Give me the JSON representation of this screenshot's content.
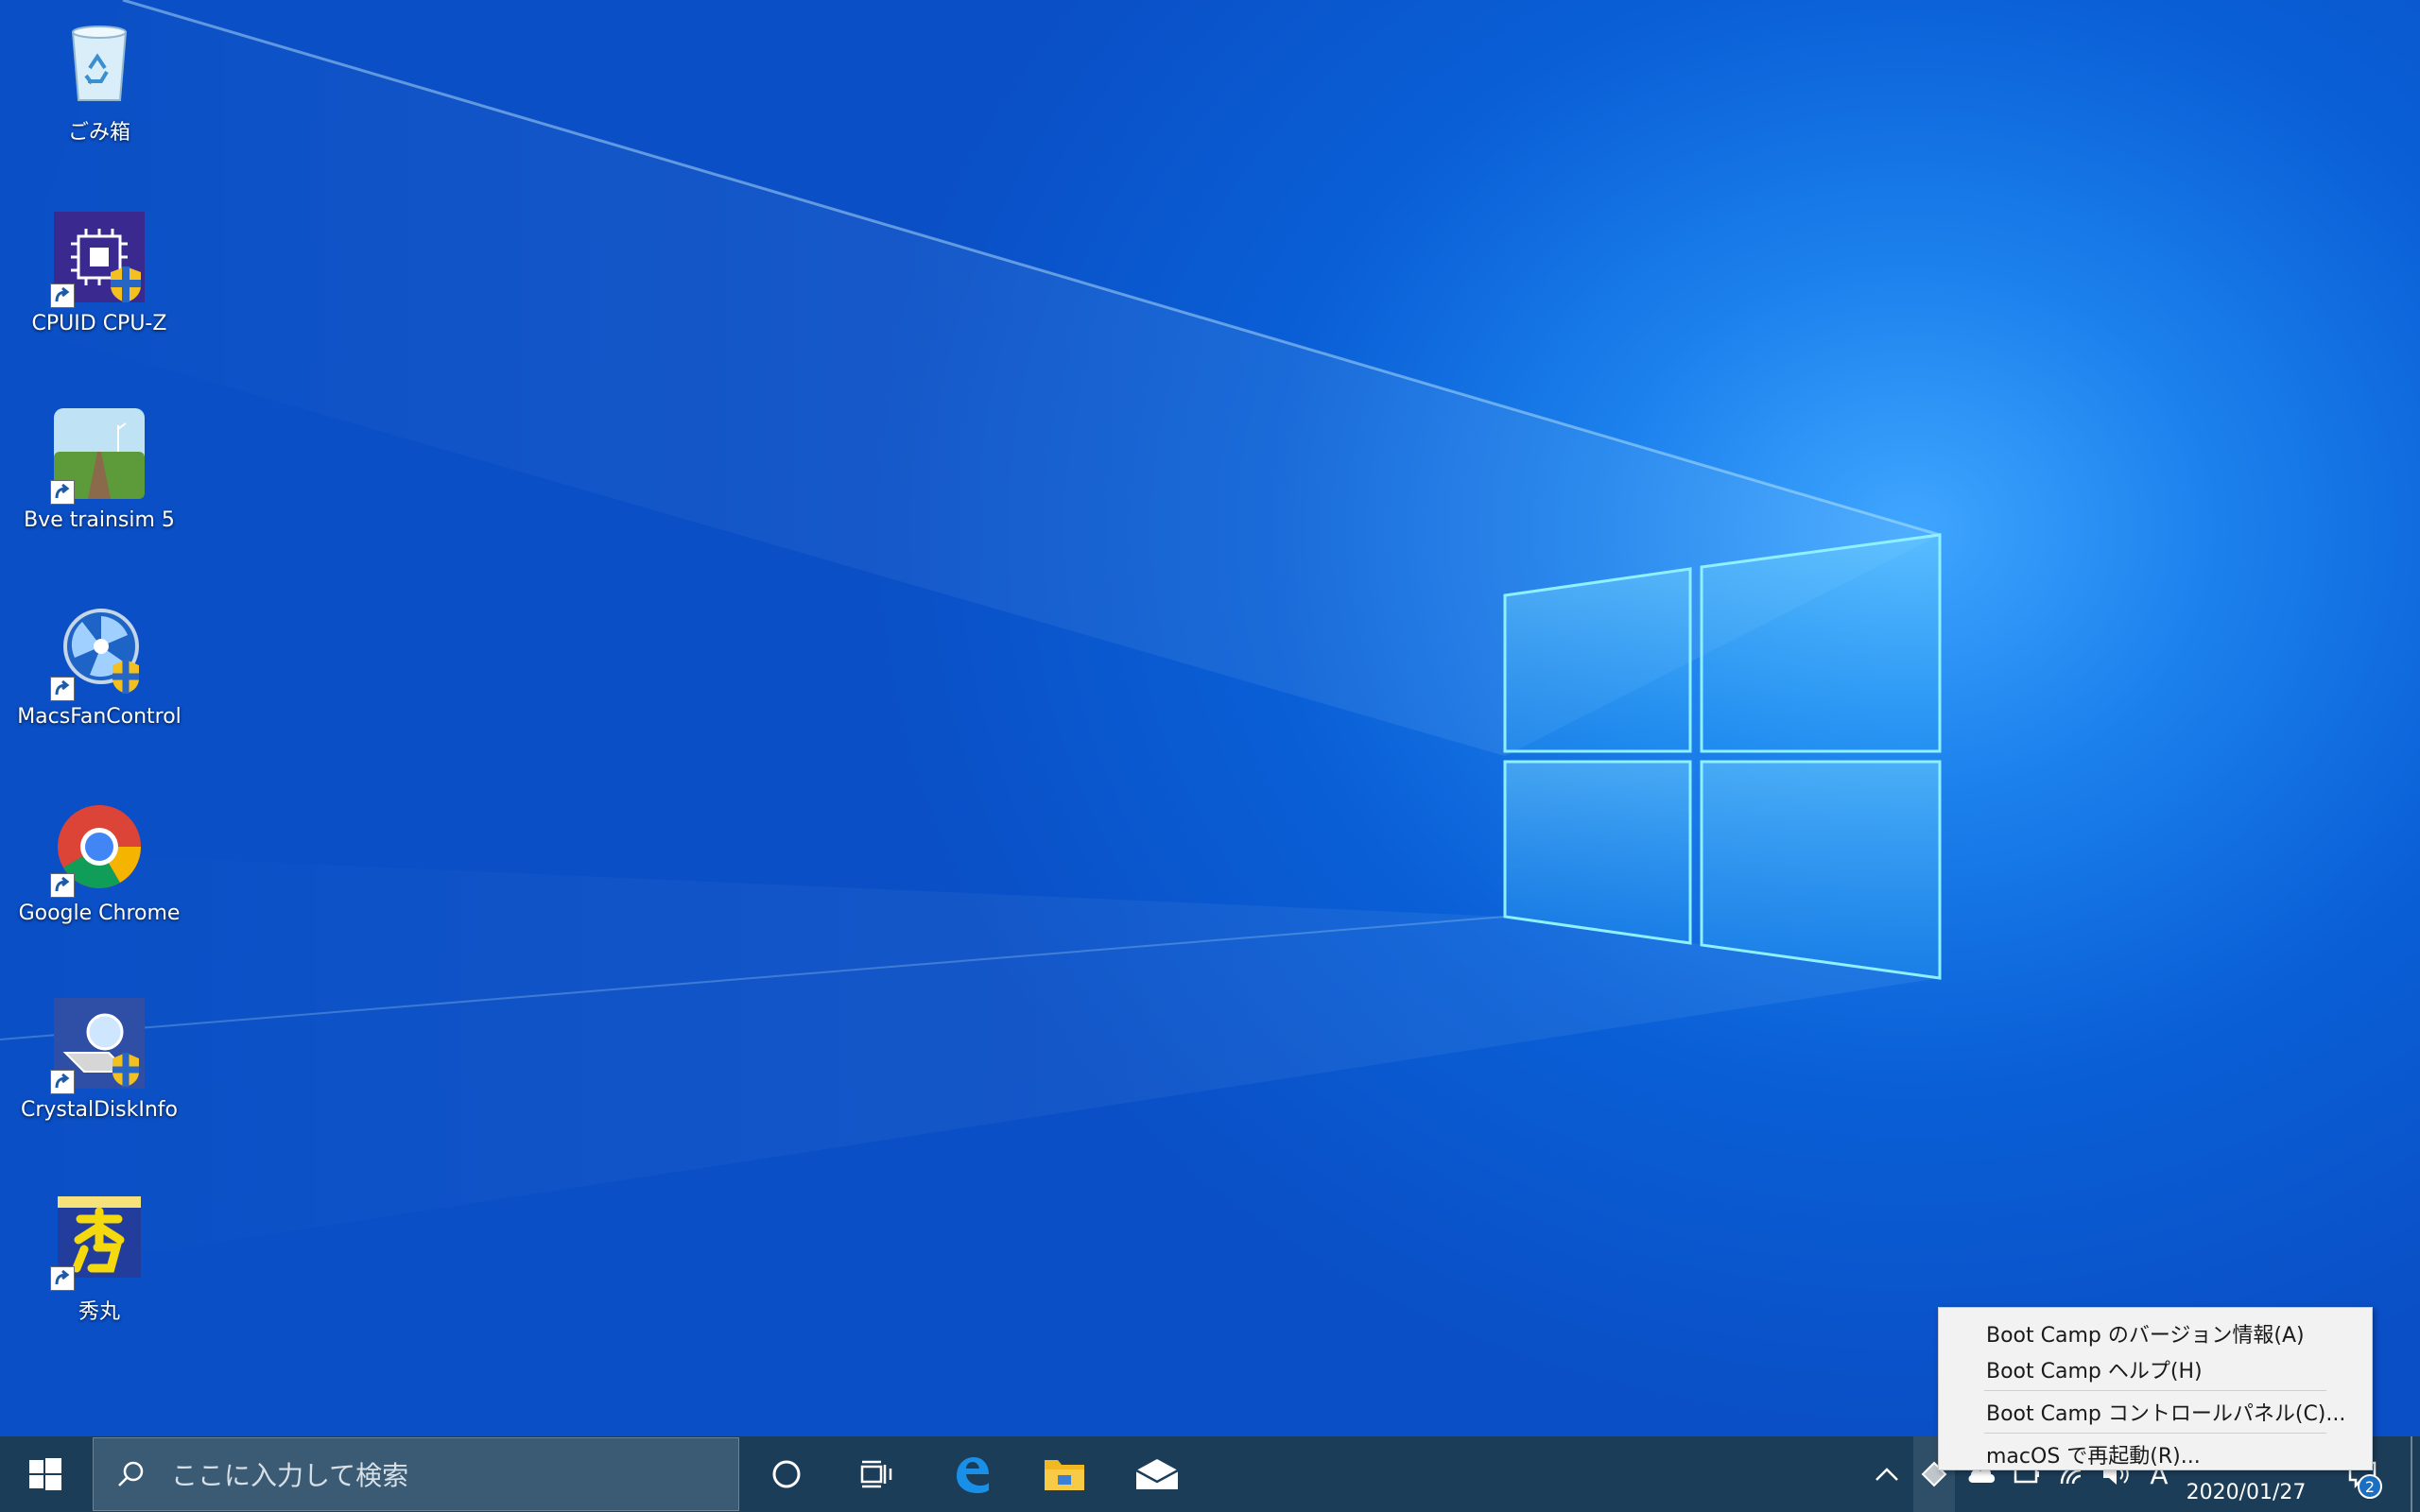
{
  "desktop": {
    "icons": [
      {
        "label": "ごみ箱",
        "icon": "recycle-bin-icon"
      },
      {
        "label": "CPUID CPU-Z",
        "icon": "cpu-z-icon"
      },
      {
        "label": "Bve trainsim 5",
        "icon": "bve-trainsim-icon"
      },
      {
        "label": "MacsFanControl",
        "icon": "macs-fan-control-icon"
      },
      {
        "label": "Google Chrome",
        "icon": "chrome-icon"
      },
      {
        "label": "CrystalDiskInfo",
        "icon": "crystaldiskinfo-icon"
      },
      {
        "label": "秀丸",
        "icon": "hidemaru-icon"
      }
    ]
  },
  "taskbar": {
    "search_placeholder": "ここに入力して検索",
    "ime_indicator": "A",
    "date": "2020/01/27",
    "notification_count": "2"
  },
  "context_menu": {
    "items": [
      "Boot Camp のバージョン情報(A)",
      "Boot Camp ヘルプ(H)",
      "Boot Camp コントロールパネル(C)...",
      "macOS で再起動(R)..."
    ]
  },
  "colors": {
    "taskbar": "#1c3d58",
    "menu_bg": "#f2f2f2",
    "wallpaper_blue": "#0a8fe8"
  }
}
